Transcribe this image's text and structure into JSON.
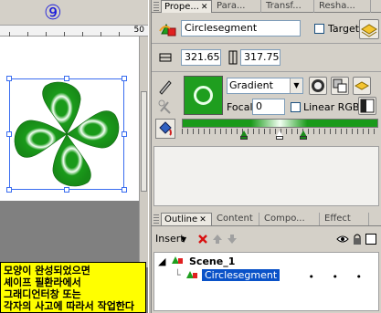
{
  "step_badge": "⑨",
  "ruler": {
    "label": "50"
  },
  "note": {
    "lines": [
      "모양이 완성되었으면",
      "셰이프 필환라에서",
      "그래디언터창 또는",
      "각자의 사고에 따라서 작업한다"
    ]
  },
  "top_tabs": [
    "Prope...",
    "Para...",
    "Transf...",
    "Resha..."
  ],
  "properties": {
    "name": "Circlesegment",
    "target_label": "Target",
    "width": "321.65",
    "height": "317.75",
    "fill_type": "Gradient",
    "focal_label": "Focal:",
    "focal_value": "0",
    "linear_rgb_label": "Linear RGB",
    "fill_color": "#1f9e1f"
  },
  "gradient": {
    "stops": [
      {
        "pos": 0.3,
        "color": "#1a8a1a"
      },
      {
        "pos": 0.5,
        "color": "#ffffff"
      },
      {
        "pos": 0.62,
        "color": "#1a8a1a"
      }
    ]
  },
  "bottom_tabs": [
    "Outline",
    "Content",
    "Compo...",
    "Effect"
  ],
  "outline": {
    "insert_label": "Insert",
    "scene": "Scene_1",
    "item": "Circlesegment",
    "dots": "• • •"
  },
  "colors": {
    "accent_blue": "#0a52c8",
    "note_yellow": "#ffff00",
    "shape_green": "#1f9e1f"
  }
}
